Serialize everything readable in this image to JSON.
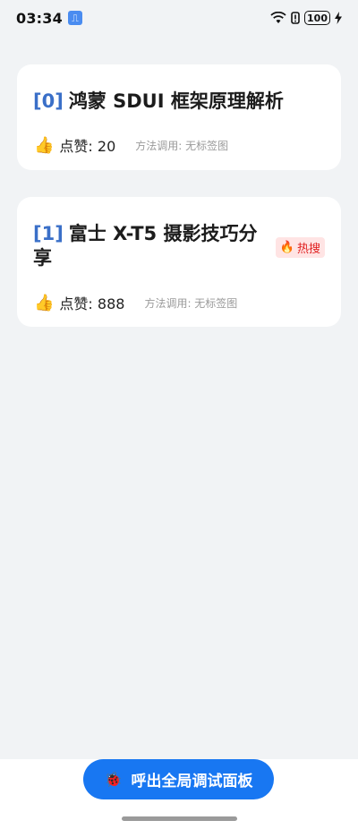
{
  "status_bar": {
    "time": "03:34",
    "battery": "100"
  },
  "cards": [
    {
      "index": "[0]",
      "title": "鸿蒙 SDUI 框架原理解析",
      "likes": "点赞: 20",
      "method": "方法调用: 无标签图"
    },
    {
      "index": "[1]",
      "title": "富士 X-T5 摄影技巧分享",
      "badge": "热搜",
      "likes": "点赞: 888",
      "method": "方法调用: 无标签图"
    }
  ],
  "debug_button": {
    "label": "呼出全局调试面板"
  },
  "icons": {
    "like": "thumbs-up-icon",
    "hot": "fire-icon",
    "debug": "bug-icon"
  }
}
